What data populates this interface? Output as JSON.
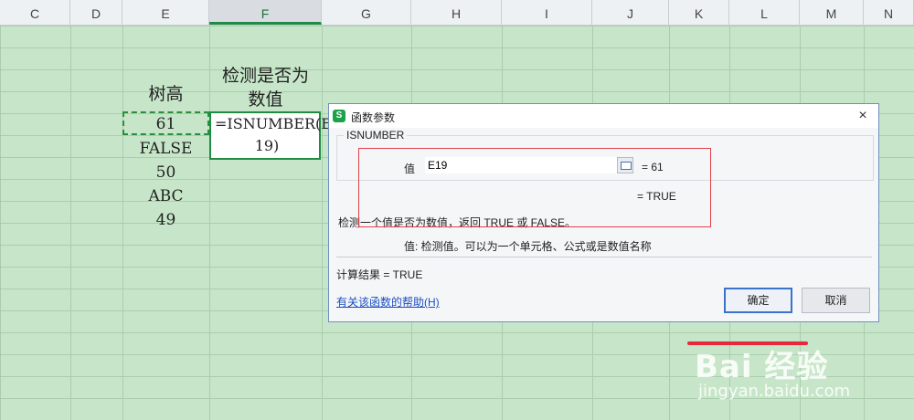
{
  "columns": [
    "C",
    "D",
    "E",
    "F",
    "G",
    "H",
    "I",
    "J",
    "K",
    "L",
    "M",
    "N"
  ],
  "selected_column": "F",
  "sheet": {
    "header_e": "树高",
    "header_f_line1": "检测是否为",
    "header_f_line2": "数值",
    "values": [
      "61",
      "FALSE",
      "50",
      "ABC",
      "49"
    ],
    "formula_line1": "=ISNUMBER(E",
    "formula_line2": "19)"
  },
  "dialog": {
    "icon_text": "S",
    "title": "函数参数",
    "close": "×",
    "function_name": "ISNUMBER",
    "arg_label": "值",
    "arg_value": "E19",
    "arg_result": "= 61",
    "formula_result": "= TRUE",
    "description": "检测一个值是否为数值，返回 TRUE 或 FALSE。",
    "arg_description": "值:  检测值。可以为一个单元格、公式或是数值名称",
    "calc_result": "计算结果 =  TRUE",
    "help_link": "有关该函数的帮助(H)",
    "ok": "确定",
    "cancel": "取消"
  },
  "watermark": {
    "brand": "Bai 经验",
    "url": "jingyan.baidu.com"
  },
  "colors": {
    "sheet_bg": "#c7e6c9",
    "accent_green": "#1f8c44",
    "annotation_red": "#e0414b"
  }
}
